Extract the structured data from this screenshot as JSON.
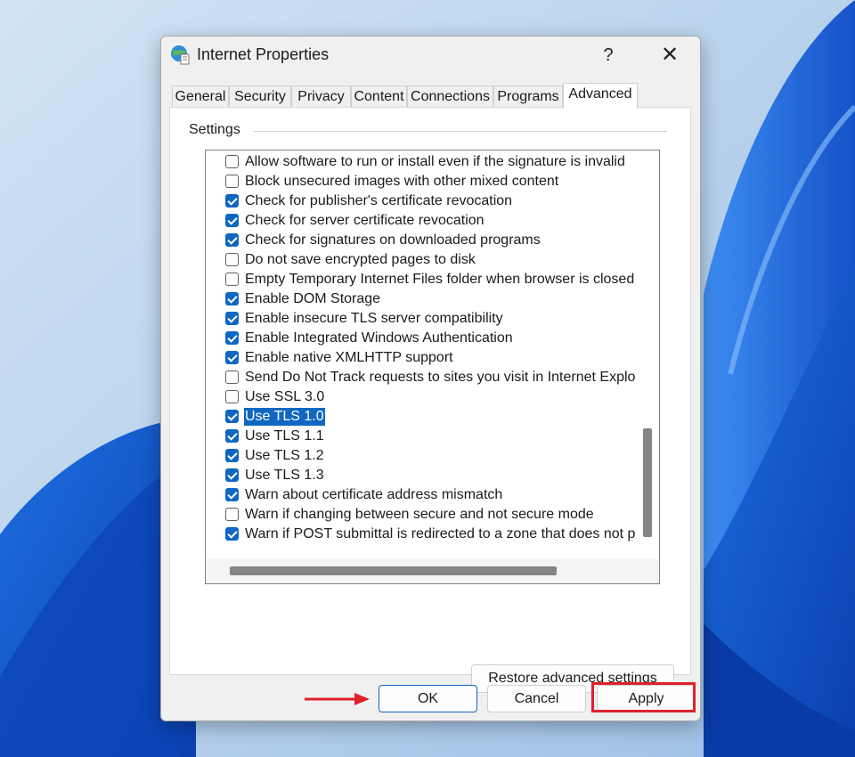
{
  "dialog": {
    "title": "Internet Properties",
    "help_glyph": "?",
    "close_glyph": "✕"
  },
  "tabs": [
    {
      "label": "General",
      "active": false
    },
    {
      "label": "Security",
      "active": false
    },
    {
      "label": "Privacy",
      "active": false
    },
    {
      "label": "Content",
      "active": false
    },
    {
      "label": "Connections",
      "active": false
    },
    {
      "label": "Programs",
      "active": false
    },
    {
      "label": "Advanced",
      "active": true
    }
  ],
  "settings": {
    "group_label": "Settings",
    "items": [
      {
        "label": "Allow software to run or install even if the signature is invalid",
        "checked": false
      },
      {
        "label": "Block unsecured images with other mixed content",
        "checked": false
      },
      {
        "label": "Check for publisher's certificate revocation",
        "checked": true
      },
      {
        "label": "Check for server certificate revocation",
        "checked": true
      },
      {
        "label": "Check for signatures on downloaded programs",
        "checked": true
      },
      {
        "label": "Do not save encrypted pages to disk",
        "checked": false
      },
      {
        "label": "Empty Temporary Internet Files folder when browser is closed",
        "checked": false
      },
      {
        "label": "Enable DOM Storage",
        "checked": true
      },
      {
        "label": "Enable insecure TLS server compatibility",
        "checked": true
      },
      {
        "label": "Enable Integrated Windows Authentication",
        "checked": true
      },
      {
        "label": "Enable native XMLHTTP support",
        "checked": true
      },
      {
        "label": "Send Do Not Track requests to sites you visit in Internet Explorer",
        "checked": false
      },
      {
        "label": "Use SSL 3.0",
        "checked": false
      },
      {
        "label": "Use TLS 1.0",
        "checked": true,
        "selected": true
      },
      {
        "label": "Use TLS 1.1",
        "checked": true
      },
      {
        "label": "Use TLS 1.2",
        "checked": true
      },
      {
        "label": "Use TLS 1.3",
        "checked": true
      },
      {
        "label": "Warn about certificate address mismatch",
        "checked": true
      },
      {
        "label": "Warn if changing between secure and not secure mode",
        "checked": false
      },
      {
        "label": "Warn if POST submittal is redirected to a zone that does not permit posts",
        "checked": true
      }
    ]
  },
  "buttons": {
    "restore": "Restore advanced settings",
    "ok": "OK",
    "cancel": "Cancel",
    "apply": "Apply"
  },
  "colors": {
    "accent": "#0f67c2",
    "highlight_box": "#e0202c",
    "annotation_arrow": "#e0202c"
  }
}
